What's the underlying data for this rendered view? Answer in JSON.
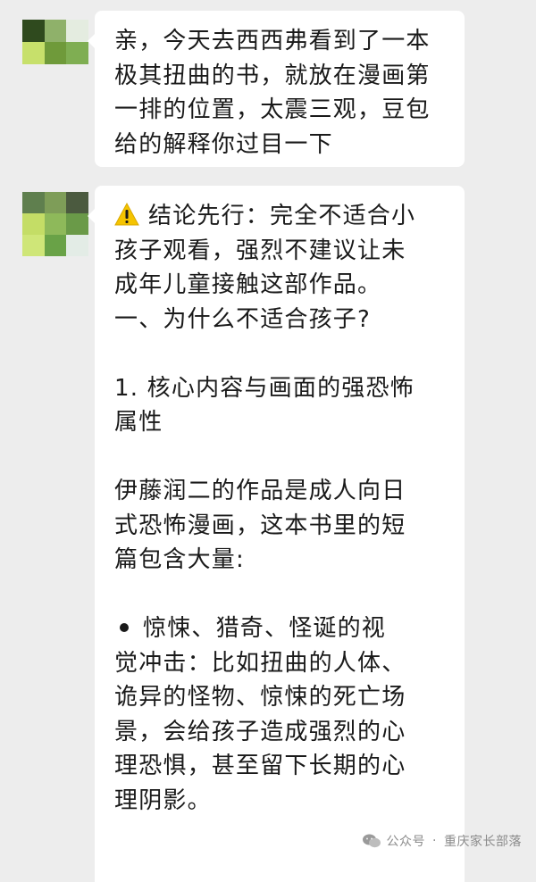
{
  "chat": {
    "message_1": {
      "lines": [
        "亲，今天去西西弗看到了一本",
        "极其扭曲的书，就放在漫画第",
        "一排的位置，太震三观，豆包",
        "给的解释你过目一下"
      ]
    },
    "message_2": {
      "warning_icon": "warning-icon",
      "lines": [
        "结论先行：完全不适合小",
        "孩子观看，强烈不建议让未",
        "成年儿童接触这部作品。",
        "一、为什么不适合孩子?",
        "",
        "1. 核心内容与画面的强恐怖",
        "属性",
        "",
        "伊藤润二的作品是成人向日",
        "式恐怖漫画，这本书里的短",
        "篇包含大量:",
        "",
        "惊悚、猎奇、怪诞的视",
        "觉冲击：比如扭曲的人体、",
        "诡异的怪物、惊悚的死亡场",
        "景，会给孩子造成强烈的心",
        "理恐惧，甚至留下长期的心",
        "理阴影。"
      ]
    }
  },
  "watermark": {
    "prefix": "公众号",
    "separator": "·",
    "name": "重庆家长部落",
    "icon": "wechat-icon"
  },
  "colors": {
    "background": "#ededed",
    "bubble": "#ffffff",
    "warning": "#f5c400"
  }
}
